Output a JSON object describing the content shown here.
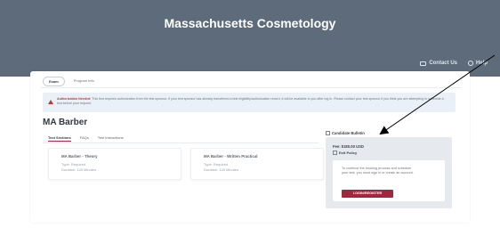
{
  "header": {
    "title": "Massachusetts Cosmetology",
    "links": [
      {
        "label": "Contact Us",
        "icon": "envelope-icon"
      },
      {
        "label": "Help",
        "icon": "help-circle-icon"
      }
    ]
  },
  "top_tabs": [
    {
      "label": "Exam",
      "active": true
    },
    {
      "label": "Program Info",
      "active": false
    }
  ],
  "alert": {
    "label": "Authorization Needed:",
    "text": "This test requires authorization from the test sponsor. If your test sponsor has already transferred a test eligibility/authorization record, it will be available to you after log in. Please contact your test sponsor if you think you are attempting to schedule a test before your request."
  },
  "exam_title": "MA Barber",
  "inner_tabs": [
    {
      "label": "Test Sections",
      "active": true
    },
    {
      "label": "FAQs",
      "active": false
    },
    {
      "label": "Test Instructions",
      "active": false
    }
  ],
  "sections": [
    {
      "title": "MA Barber - Theory",
      "type": "Type: Required",
      "duration": "Duration: 120 Minutes"
    },
    {
      "title": "MA Barber - Written Practical",
      "type": "Type: Required",
      "duration": "Duration: 120 Minutes"
    }
  ],
  "bulletin": {
    "label": "Candidate Bulletin",
    "fee": "Fee: $180.00 USD",
    "policy": "Exit Policy",
    "message": "To continue the booking process and schedule your test, you must sign in or create an account.",
    "button": "LOGIN/REGISTER"
  },
  "colors": {
    "header_bg": "#5d6b7a",
    "accent": "#a3263f",
    "alert_bg": "#eaf0f7",
    "bulletin_bg": "#e6e9ed"
  }
}
